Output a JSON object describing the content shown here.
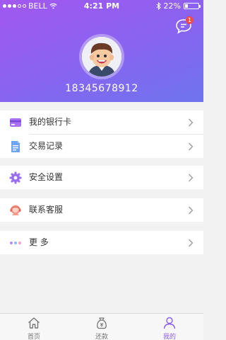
{
  "status_bar": {
    "carrier": "BELL",
    "time": "4:21 PM",
    "battery": "22%",
    "battery_level": 0.22
  },
  "header": {
    "message_badge": "1",
    "phone": "18345678912"
  },
  "menu": [
    {
      "label": "我的银行卡",
      "icon": "bank-card-icon"
    },
    {
      "label": "交易记录",
      "icon": "transaction-record-icon"
    },
    {
      "label": "安全设置",
      "icon": "security-gear-icon"
    },
    {
      "label": "联系客服",
      "icon": "customer-service-icon"
    },
    {
      "label": "更 多",
      "icon": "more-dots-icon"
    }
  ],
  "tabs": [
    {
      "label": "首页",
      "icon": "home-icon",
      "active": false
    },
    {
      "label": "还款",
      "icon": "repay-bag-icon",
      "active": false
    },
    {
      "label": "我的",
      "icon": "user-icon",
      "active": true
    }
  ],
  "colors": {
    "accent": "#8a5cf0",
    "badge": "#f04a4a",
    "gradient_start": "#a257f0",
    "gradient_end": "#6e74ee"
  }
}
